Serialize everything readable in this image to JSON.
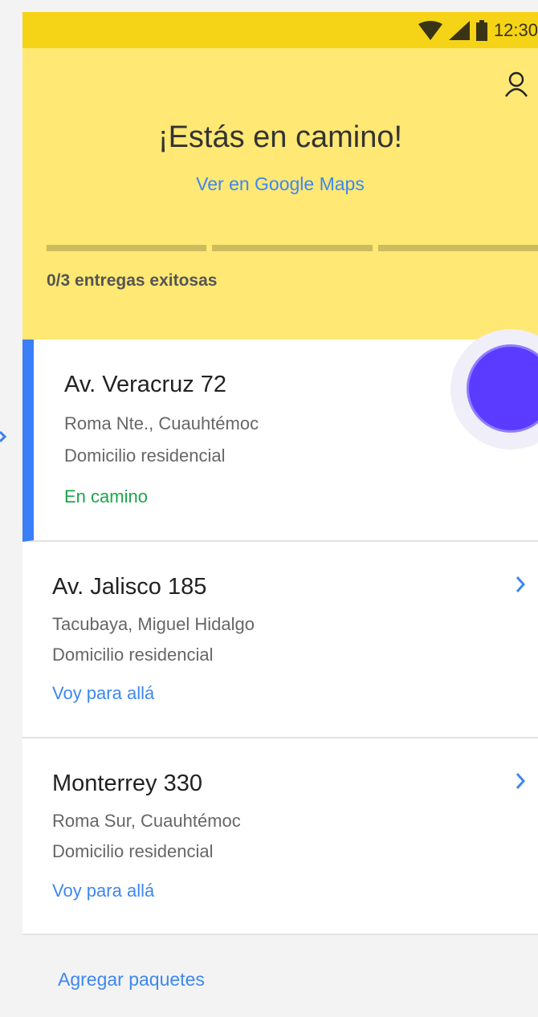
{
  "status_bar": {
    "time": "12:30"
  },
  "header": {
    "title": "¡Estás en camino!",
    "maps_link": "Ver en Google Maps",
    "progress_label": "0/3 entregas exitosas",
    "progress": {
      "completed": 0,
      "total": 3
    }
  },
  "deliveries": [
    {
      "address": "Av. Veracruz 72",
      "area": "Roma Nte., Cuauhtémoc",
      "type": "Domicilio residencial",
      "status": "En camino"
    },
    {
      "address": "Av. Jalisco 185",
      "area": "Tacubaya, Miguel Hidalgo",
      "type": "Domicilio residencial",
      "status": "Voy para allá"
    },
    {
      "address": "Monterrey 330",
      "area": "Roma Sur, Cuauhtémoc",
      "type": "Domicilio residencial",
      "status": "Voy para allá"
    }
  ],
  "footer": {
    "add_packages": "Agregar paquetes"
  },
  "colors": {
    "status_bar": "#f5d316",
    "header": "#ffe873",
    "accent_blue": "#3d87f0",
    "active_green": "#1aa64b",
    "fab": "#5b3bff"
  }
}
